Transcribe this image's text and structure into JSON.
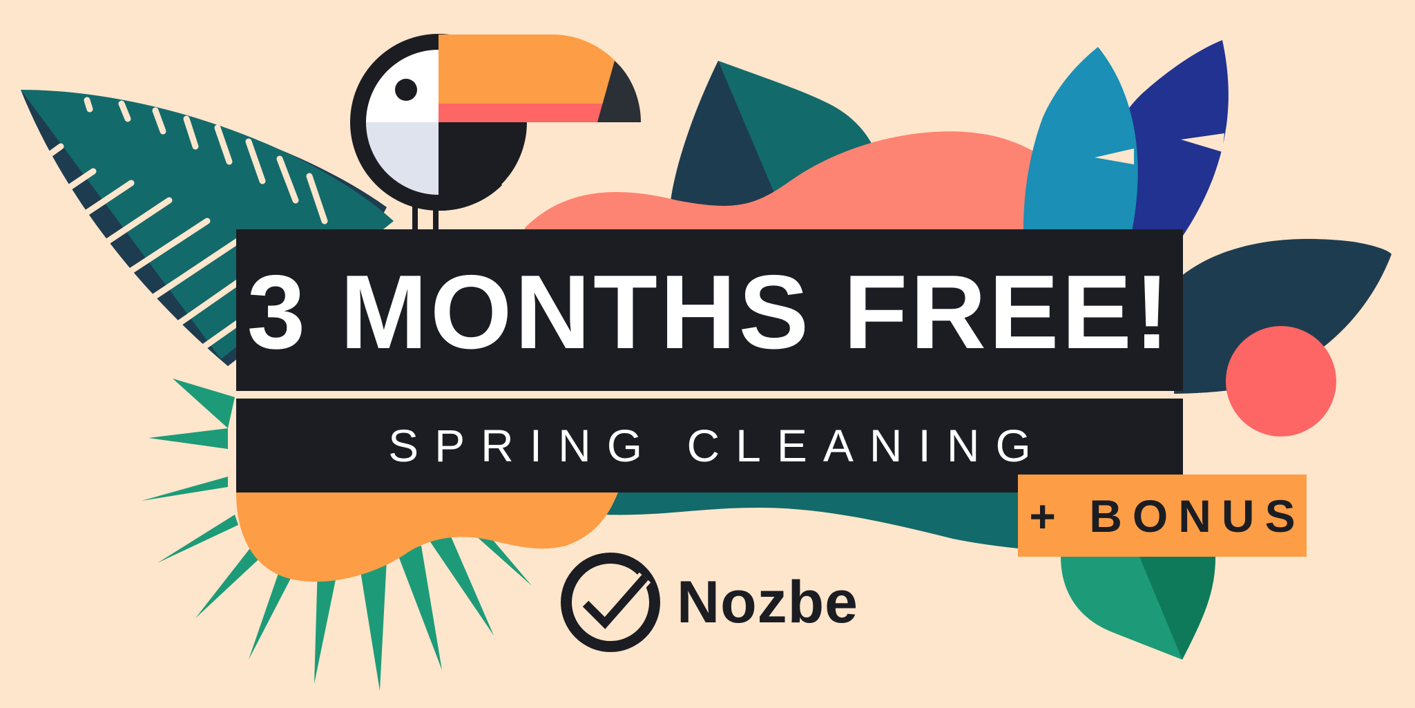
{
  "promo": {
    "headline": "3 MONTHS FREE!",
    "subtitle": "SPRING CLEANING",
    "bonus": "+ BONUS"
  },
  "brand": {
    "name": "Nozbe",
    "logo_icon": "check-circle-icon"
  },
  "colors": {
    "background": "#fde6cc",
    "banner": "#1b1d23",
    "orange": "#fd9d45",
    "salmon": "#fd8472",
    "coral": "#fe6565",
    "teal": "#136a6a",
    "dark_teal": "#1e3c4f",
    "green": "#1d9b78",
    "blue": "#1b8fb5",
    "indigo": "#223290"
  },
  "decorations": [
    "toucan-icon",
    "fern-leaf-icon",
    "palm-leaf-icon",
    "monstera-leaf-icon",
    "tropical-leaf-icon",
    "sun-circle-icon"
  ]
}
